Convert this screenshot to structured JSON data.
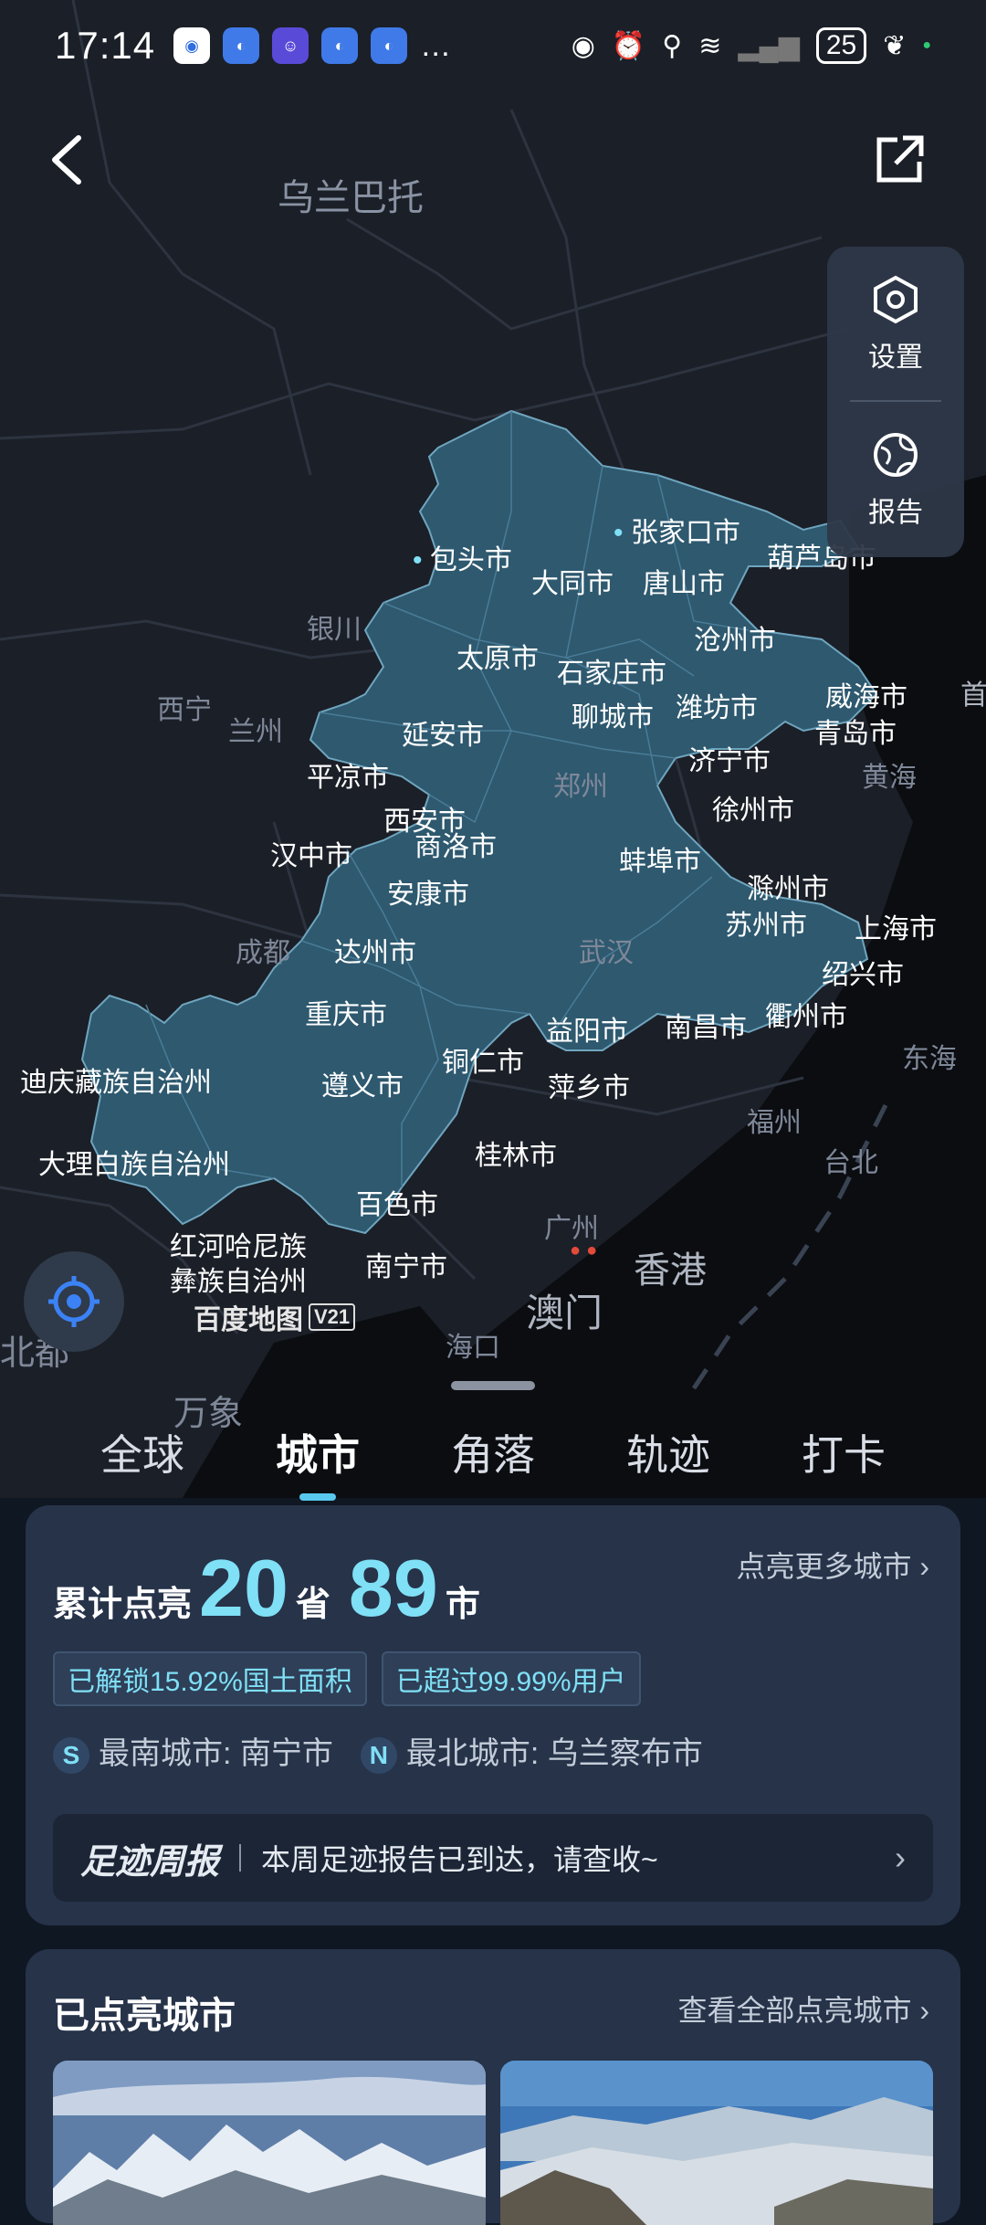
{
  "status_bar": {
    "time": "17:14",
    "overflow": "…",
    "battery": "25",
    "icons": [
      "eye-icon",
      "alarm-icon",
      "location-icon",
      "wifi-icon",
      "signal-icon",
      "leaf-icon"
    ]
  },
  "map": {
    "region_labels": [
      {
        "text": "乌兰巴托",
        "key": "a"
      },
      {
        "text": "银川",
        "key": "b"
      },
      {
        "text": "西宁",
        "key": "c"
      },
      {
        "text": "兰州",
        "key": "d"
      },
      {
        "text": "郑州",
        "key": "e"
      },
      {
        "text": "成都",
        "key": "f"
      },
      {
        "text": "武汉",
        "key": "g"
      },
      {
        "text": "黄海",
        "key": "h"
      },
      {
        "text": "东海",
        "key": "i"
      },
      {
        "text": "福州",
        "key": "j"
      },
      {
        "text": "台北",
        "key": "k"
      },
      {
        "text": "广州",
        "key": "l"
      },
      {
        "text": "香港",
        "key": "m"
      },
      {
        "text": "澳门",
        "key": "n"
      },
      {
        "text": "海口",
        "key": "o"
      },
      {
        "text": "万象",
        "key": "p"
      },
      {
        "text": "北都",
        "key": "q"
      },
      {
        "text": "首",
        "key": "r"
      }
    ],
    "cities": [
      "包头市",
      "大同市",
      "张家口市",
      "唐山市",
      "葫芦岛市",
      "太原市",
      "石家庄市",
      "沧州市",
      "聊城市",
      "潍坊市",
      "威海市",
      "青岛市",
      "延安市",
      "济宁市",
      "平凉市",
      "西安市",
      "徐州市",
      "商洛市",
      "汉中市",
      "蚌埠市",
      "安康市",
      "滁州市",
      "苏州市",
      "上海市",
      "达州市",
      "绍兴市",
      "重庆市",
      "益阳市",
      "南昌市",
      "衢州市",
      "迪庆藏族自治州",
      "铜仁市",
      "遵义市",
      "萍乡市",
      "大理白族自治州",
      "桂林市",
      "百色市",
      "红河哈尼族",
      "彝族自治州",
      "南宁市"
    ],
    "logo_text": "百度地图",
    "logo_version": "V21"
  },
  "side_panel": {
    "settings_label": "设置",
    "report_label": "报告"
  },
  "tabs": [
    {
      "label": "全球",
      "active": false
    },
    {
      "label": "城市",
      "active": true
    },
    {
      "label": "角落",
      "active": false
    },
    {
      "label": "轨迹",
      "active": false
    },
    {
      "label": "打卡",
      "active": false
    }
  ],
  "stats": {
    "prefix": "累计点亮",
    "provinces": "20",
    "province_unit": "省",
    "cities": "89",
    "city_unit": "市",
    "more_link": "点亮更多城市",
    "chip_area": "已解锁15.92%国土面积",
    "chip_users": "已超过99.99%用户",
    "south_badge": "S",
    "south_text": "最南城市: 南宁市",
    "north_badge": "N",
    "north_text": "最北城市: 乌兰察布市"
  },
  "weekly": {
    "title": "足迹周报",
    "message": "本周足迹报告已到达，请查收~",
    "chevron": "›"
  },
  "lit_cities": {
    "title": "已点亮城市",
    "link": "查看全部点亮城市"
  },
  "colors": {
    "accent": "#7fe0f6",
    "lit_region": "#2f5c74",
    "map_bg": "#1b1f27",
    "sea": "#0a0c10"
  }
}
